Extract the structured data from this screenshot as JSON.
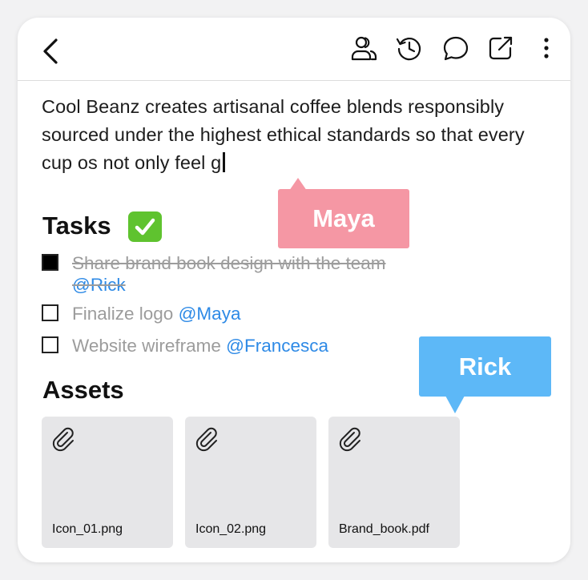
{
  "toolbar": {
    "back_icon": "chevron-left-icon",
    "icons": [
      "collaborators-icon",
      "history-icon",
      "comment-icon",
      "share-icon",
      "more-icon"
    ]
  },
  "document": {
    "body_text": "Cool Beanz creates artisanal coffee blends responsibly sourced under the highest ethical standards so that every cup os not only feel g",
    "tasks_heading": "Tasks",
    "tasks": [
      {
        "text": "Share brand book design with the team",
        "mention": "@Rick",
        "done": true
      },
      {
        "text": "Finalize logo",
        "mention": "@Maya",
        "done": false
      },
      {
        "text": "Website wireframe",
        "mention": "@Francesca",
        "done": false
      }
    ],
    "assets_heading": "Assets",
    "assets": [
      {
        "name": "Icon_01.png"
      },
      {
        "name": "Icon_02.png"
      },
      {
        "name": "Brand_book.pdf"
      }
    ]
  },
  "cursors": [
    {
      "name": "Maya",
      "color": "#f597a4"
    },
    {
      "name": "Rick",
      "color": "#5db8f7"
    }
  ],
  "colors": {
    "mention": "#2e8ae6",
    "task_text": "#9c9c9c",
    "check_emoji": "#5fc32f"
  }
}
